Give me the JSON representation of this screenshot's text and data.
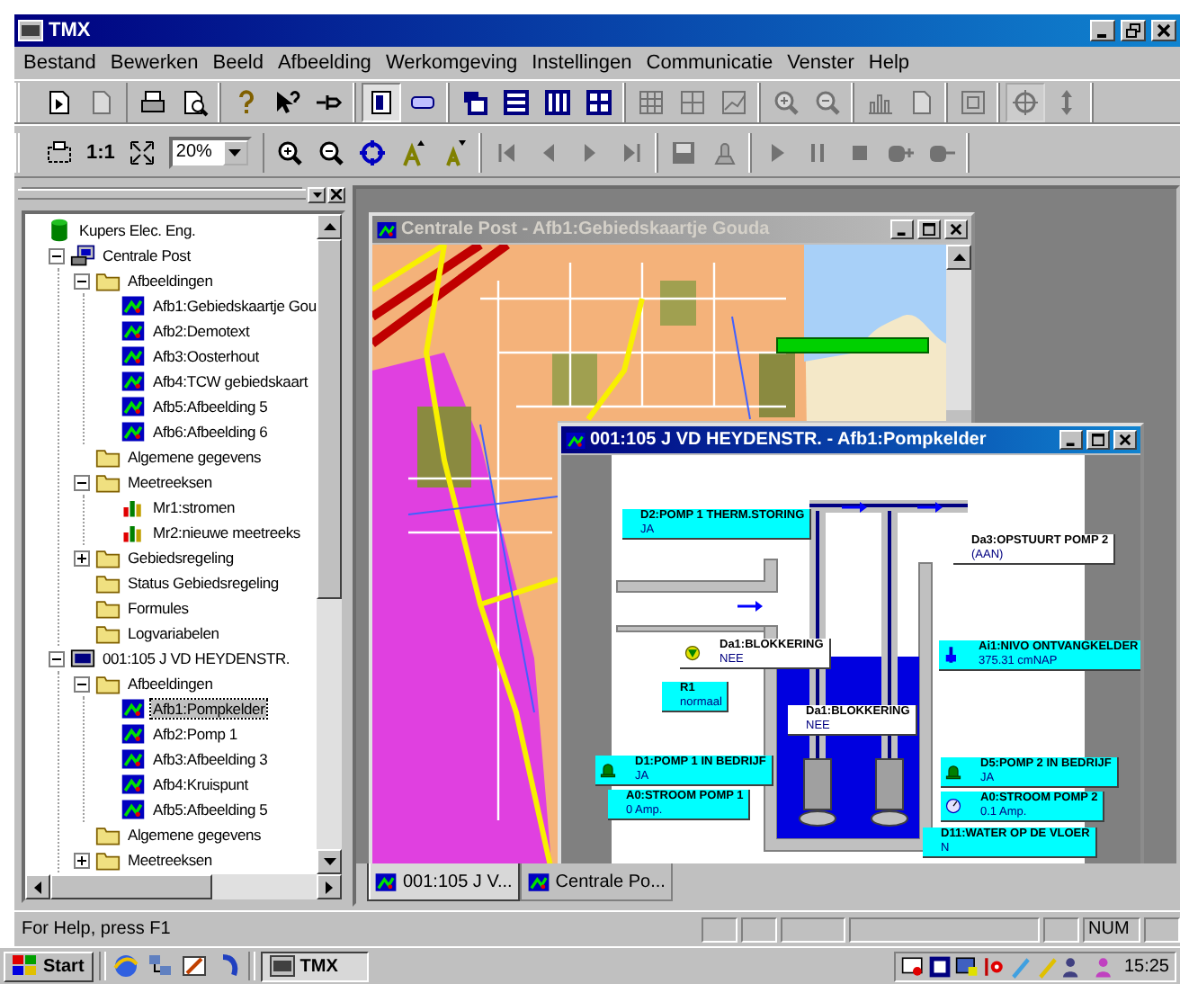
{
  "window": {
    "title": "TMX"
  },
  "menu": [
    "Bestand",
    "Bewerken",
    "Beeld",
    "Afbeelding",
    "Werkomgeving",
    "Instellingen",
    "Communicatie",
    "Venster",
    "Help"
  ],
  "toolbars": [
    {
      "groups": [
        [
          {
            "kind": "document",
            "disabled": false,
            "pressed": false
          },
          {
            "kind": "page",
            "disabled": true,
            "pressed": false
          }
        ],
        [
          {
            "kind": "printer",
            "disabled": false,
            "pressed": false
          },
          {
            "kind": "print-preview",
            "disabled": false,
            "pressed": false
          }
        ],
        [
          {
            "kind": "help",
            "disabled": false,
            "pressed": false
          },
          {
            "kind": "pointer-help",
            "disabled": false,
            "pressed": false
          },
          {
            "kind": "pin",
            "disabled": false,
            "pressed": false
          }
        ],
        [
          {
            "kind": "panel",
            "disabled": false,
            "pressed": true
          },
          {
            "kind": "comment",
            "disabled": false,
            "pressed": false
          }
        ],
        [
          {
            "kind": "cascade",
            "disabled": false,
            "pressed": false
          },
          {
            "kind": "tile-horizontal",
            "disabled": false,
            "pressed": false
          },
          {
            "kind": "tile-vertical",
            "disabled": false,
            "pressed": false
          },
          {
            "kind": "tile-grid",
            "disabled": false,
            "pressed": false
          }
        ],
        [
          {
            "kind": "table",
            "disabled": true,
            "pressed": false
          },
          {
            "kind": "table-split",
            "disabled": true,
            "pressed": false
          },
          {
            "kind": "line-chart",
            "disabled": true,
            "pressed": false
          }
        ],
        [
          {
            "kind": "zoom-in",
            "disabled": true,
            "pressed": false
          },
          {
            "kind": "zoom-out",
            "disabled": true,
            "pressed": false
          }
        ],
        [
          {
            "kind": "bar-chart",
            "disabled": true,
            "pressed": false
          },
          {
            "kind": "page",
            "disabled": true,
            "pressed": false
          }
        ],
        [
          {
            "kind": "frame",
            "disabled": true,
            "pressed": false
          }
        ],
        [
          {
            "kind": "compass",
            "disabled": true,
            "pressed": true
          },
          {
            "kind": "updown-arrows",
            "disabled": true,
            "pressed": false
          }
        ]
      ]
    },
    {
      "groups": [
        [
          {
            "kind": "layout",
            "disabled": false,
            "pressed": false
          },
          {
            "kind": "ratio",
            "label": "1:1",
            "disabled": false,
            "pressed": false
          },
          {
            "kind": "fit",
            "disabled": false,
            "pressed": false
          },
          {
            "kind": "zoom-combo",
            "value": "20%",
            "disabled": false,
            "pressed": false
          }
        ],
        [
          {
            "kind": "zoom-in",
            "disabled": false,
            "pressed": false
          },
          {
            "kind": "zoom-out",
            "disabled": false,
            "pressed": false
          },
          {
            "kind": "crosshair",
            "disabled": false,
            "pressed": false
          },
          {
            "kind": "font-larger",
            "disabled": false,
            "pressed": false
          },
          {
            "kind": "font-smaller",
            "disabled": false,
            "pressed": false
          }
        ],
        [
          {
            "kind": "first",
            "disabled": true,
            "pressed": false
          },
          {
            "kind": "previous",
            "disabled": true,
            "pressed": false
          },
          {
            "kind": "next",
            "disabled": true,
            "pressed": false
          },
          {
            "kind": "last",
            "disabled": true,
            "pressed": false
          }
        ],
        [
          {
            "kind": "save",
            "disabled": true,
            "pressed": false
          },
          {
            "kind": "stamp",
            "disabled": true,
            "pressed": false
          }
        ],
        [
          {
            "kind": "play",
            "disabled": true,
            "pressed": false
          },
          {
            "kind": "pause",
            "disabled": true,
            "pressed": false
          },
          {
            "kind": "stop",
            "disabled": true,
            "pressed": false
          },
          {
            "kind": "record",
            "disabled": true,
            "pressed": false
          },
          {
            "kind": "record-end",
            "disabled": true,
            "pressed": false
          }
        ]
      ]
    }
  ],
  "tree": {
    "items": [
      {
        "label": "Kupers Elec. Eng.",
        "kind": "database",
        "selected": false,
        "children": [
          {
            "label": "Centrale Post",
            "kind": "computer",
            "expanded": true,
            "selected": false,
            "children": [
              {
                "label": "Afbeeldingen",
                "kind": "folder",
                "expanded": true,
                "selected": false,
                "children": [
                  {
                    "label": "Afb1:Gebiedskaartje Gou",
                    "kind": "picture",
                    "selected": false
                  },
                  {
                    "label": "Afb2:Demotext",
                    "kind": "picture",
                    "selected": false
                  },
                  {
                    "label": "Afb3:Oosterhout",
                    "kind": "picture",
                    "selected": false
                  },
                  {
                    "label": "Afb4:TCW gebiedskaart",
                    "kind": "picture",
                    "selected": false
                  },
                  {
                    "label": "Afb5:Afbeelding 5",
                    "kind": "picture",
                    "selected": false
                  },
                  {
                    "label": "Afb6:Afbeelding 6",
                    "kind": "picture",
                    "selected": false
                  }
                ]
              },
              {
                "label": "Algemene gegevens",
                "kind": "folder",
                "selected": false
              },
              {
                "label": "Meetreeksen",
                "kind": "folder",
                "expanded": true,
                "selected": false,
                "children": [
                  {
                    "label": "Mr1:stromen",
                    "kind": "chart",
                    "selected": false
                  },
                  {
                    "label": "Mr2:nieuwe meetreeks",
                    "kind": "chart",
                    "selected": false
                  }
                ]
              },
              {
                "label": "Gebiedsregeling",
                "kind": "folder",
                "expanded": false,
                "selected": false
              },
              {
                "label": "Status Gebiedsregeling",
                "kind": "folder",
                "selected": false
              },
              {
                "label": "Formules",
                "kind": "folder",
                "selected": false
              },
              {
                "label": "Logvariabelen",
                "kind": "folder",
                "selected": false
              }
            ]
          },
          {
            "label": "001:105 J VD HEYDENSTR.",
            "kind": "station",
            "expanded": true,
            "selected": false,
            "children": [
              {
                "label": "Afbeeldingen",
                "kind": "folder",
                "expanded": true,
                "selected": false,
                "children": [
                  {
                    "label": "Afb1:Pompkelder",
                    "kind": "picture",
                    "selected": true
                  },
                  {
                    "label": "Afb2:Pomp 1",
                    "kind": "picture",
                    "selected": false
                  },
                  {
                    "label": "Afb3:Afbeelding 3",
                    "kind": "picture",
                    "selected": false
                  },
                  {
                    "label": "Afb4:Kruispunt",
                    "kind": "picture",
                    "selected": false
                  },
                  {
                    "label": "Afb5:Afbeelding 5",
                    "kind": "picture",
                    "selected": false
                  }
                ]
              },
              {
                "label": "Algemene gegevens",
                "kind": "folder",
                "selected": false
              },
              {
                "label": "Meetreeksen",
                "kind": "folder",
                "expanded": false,
                "selected": false
              }
            ]
          }
        ]
      }
    ]
  },
  "map_window": {
    "title": "Centrale Post - Afb1:Gebiedskaartje Gouda",
    "active": false
  },
  "pump_window": {
    "title": "001:105 J VD HEYDENSTR. - Afb1:Pompkelder",
    "active": true,
    "labels": [
      {
        "title": "D2:POMP 1 THERM.STORING",
        "value": "JA",
        "color": "#00ffff",
        "kind": "plain"
      },
      {
        "title": "Da3:OPSTUURT POMP 2",
        "value": "(AAN)",
        "color": "#ffffff",
        "kind": "plain"
      },
      {
        "title": "Da1:BLOKKERING",
        "value": "NEE",
        "color": "#ffffff",
        "kind": "valve"
      },
      {
        "title": "R1",
        "value": "normaal",
        "color": "#00ffff",
        "kind": "plain"
      },
      {
        "title": "Ai1:NIVO ONTVANGKELDER",
        "value": "375.31 cmNAP",
        "color": "#00ffff",
        "kind": "level"
      },
      {
        "title": "Da1:BLOKKERING",
        "value": "NEE",
        "color": "#ffffff",
        "kind": "plain"
      },
      {
        "title": "D1:POMP 1 IN BEDRIJF",
        "value": "JA",
        "color": "#00ffff",
        "kind": "bell"
      },
      {
        "title": "A0:STROOM POMP 1",
        "value": "0 Amp.",
        "color": "#00ffff",
        "kind": "plain"
      },
      {
        "title": "D5:POMP 2 IN BEDRIJF",
        "value": "JA",
        "color": "#00ffff",
        "kind": "bell"
      },
      {
        "title": "A0:STROOM POMP 2",
        "value": "0.1 Amp.",
        "color": "#00ffff",
        "kind": "gauge"
      },
      {
        "title": "D11:WATER OP DE VLOER",
        "value": "N",
        "color": "#00ffff",
        "kind": "plain"
      }
    ]
  },
  "window_tabs": [
    {
      "label": "001:105 J V...",
      "selected": true
    },
    {
      "label": "Centrale Po...",
      "selected": false
    }
  ],
  "status_bar": {
    "text": "For Help, press F1",
    "indicators": [
      "NUM"
    ]
  },
  "taskbar": {
    "start": "Start",
    "tasks": [
      "TMX"
    ],
    "clock": "15:25"
  }
}
